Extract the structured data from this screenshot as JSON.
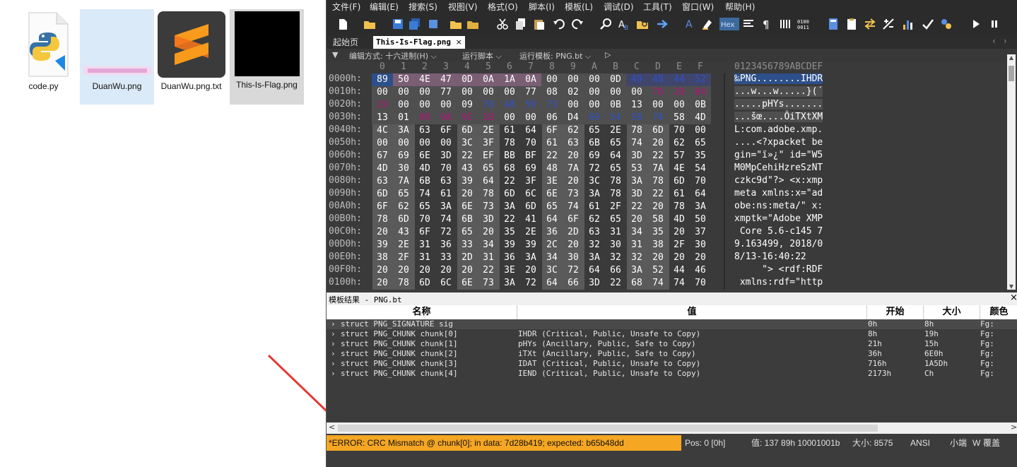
{
  "desktop": {
    "icons": [
      {
        "label": "code.py"
      },
      {
        "label": "DuanWu.png"
      },
      {
        "label": "DuanWu.png.txt"
      },
      {
        "label": "This-Is-Flag.png"
      }
    ]
  },
  "menu": [
    "文件(F)",
    "编辑(E)",
    "搜索(S)",
    "视图(V)",
    "格式(O)",
    "脚本(I)",
    "模板(L)",
    "调试(D)",
    "工具(T)",
    "窗口(W)",
    "帮助(H)"
  ],
  "tabs": {
    "start": "起始页",
    "file": "This-Is-Flag.png"
  },
  "editbar": {
    "edit_mode": "编辑方式: 十六进制(H) ⌵",
    "run_script": "运行脚本 ⌵",
    "run_template": "运行模板: PNG.bt ⌵"
  },
  "hex": {
    "column_headers": [
      "0",
      "1",
      "2",
      "3",
      "4",
      "5",
      "6",
      "7",
      "8",
      "9",
      "A",
      "B",
      "C",
      "D",
      "E",
      "F"
    ],
    "ascii_header": "0123456789ABCDEF",
    "rows": [
      {
        "addr": "0000h:",
        "bytes": [
          "89",
          "50",
          "4E",
          "47",
          "0D",
          "0A",
          "1A",
          "0A",
          "00",
          "00",
          "00",
          "0D",
          "49",
          "48",
          "44",
          "52"
        ],
        "ascii": "‰PNG........IHDR"
      },
      {
        "addr": "0010h:",
        "bytes": [
          "00",
          "00",
          "00",
          "77",
          "00",
          "00",
          "00",
          "77",
          "08",
          "02",
          "00",
          "00",
          "00",
          "7D",
          "28",
          "B4"
        ],
        "ascii": "...w...w.....}(´"
      },
      {
        "addr": "0020h:",
        "bytes": [
          "19",
          "00",
          "00",
          "00",
          "09",
          "70",
          "48",
          "59",
          "73",
          "00",
          "00",
          "0B",
          "13",
          "00",
          "00",
          "0B"
        ],
        "ascii": ".....pHYs......."
      },
      {
        "addr": "0030h:",
        "bytes": [
          "13",
          "01",
          "00",
          "9A",
          "9C",
          "18",
          "00",
          "00",
          "06",
          "D4",
          "69",
          "54",
          "58",
          "74",
          "58",
          "4D"
        ],
        "ascii": "...šœ....ÔiTXtXM"
      },
      {
        "addr": "0040h:",
        "bytes": [
          "4C",
          "3A",
          "63",
          "6F",
          "6D",
          "2E",
          "61",
          "64",
          "6F",
          "62",
          "65",
          "2E",
          "78",
          "6D",
          "70",
          "00"
        ],
        "ascii": "L:com.adobe.xmp."
      },
      {
        "addr": "0050h:",
        "bytes": [
          "00",
          "00",
          "00",
          "00",
          "3C",
          "3F",
          "78",
          "70",
          "61",
          "63",
          "6B",
          "65",
          "74",
          "20",
          "62",
          "65"
        ],
        "ascii": "....<?xpacket be"
      },
      {
        "addr": "0060h:",
        "bytes": [
          "67",
          "69",
          "6E",
          "3D",
          "22",
          "EF",
          "BB",
          "BF",
          "22",
          "20",
          "69",
          "64",
          "3D",
          "22",
          "57",
          "35"
        ],
        "ascii": "gin=\"ï»¿\" id=\"W5"
      },
      {
        "addr": "0070h:",
        "bytes": [
          "4D",
          "30",
          "4D",
          "70",
          "43",
          "65",
          "68",
          "69",
          "48",
          "7A",
          "72",
          "65",
          "53",
          "7A",
          "4E",
          "54"
        ],
        "ascii": "M0MpCehiHzreSzNT"
      },
      {
        "addr": "0080h:",
        "bytes": [
          "63",
          "7A",
          "6B",
          "63",
          "39",
          "64",
          "22",
          "3F",
          "3E",
          "20",
          "3C",
          "78",
          "3A",
          "78",
          "6D",
          "70"
        ],
        "ascii": "czkc9d\"?> <x:xmp"
      },
      {
        "addr": "0090h:",
        "bytes": [
          "6D",
          "65",
          "74",
          "61",
          "20",
          "78",
          "6D",
          "6C",
          "6E",
          "73",
          "3A",
          "78",
          "3D",
          "22",
          "61",
          "64"
        ],
        "ascii": "meta xmlns:x=\"ad"
      },
      {
        "addr": "00A0h:",
        "bytes": [
          "6F",
          "62",
          "65",
          "3A",
          "6E",
          "73",
          "3A",
          "6D",
          "65",
          "74",
          "61",
          "2F",
          "22",
          "20",
          "78",
          "3A"
        ],
        "ascii": "obe:ns:meta/\" x:"
      },
      {
        "addr": "00B0h:",
        "bytes": [
          "78",
          "6D",
          "70",
          "74",
          "6B",
          "3D",
          "22",
          "41",
          "64",
          "6F",
          "62",
          "65",
          "20",
          "58",
          "4D",
          "50"
        ],
        "ascii": "xmptk=\"Adobe XMP"
      },
      {
        "addr": "00C0h:",
        "bytes": [
          "20",
          "43",
          "6F",
          "72",
          "65",
          "20",
          "35",
          "2E",
          "36",
          "2D",
          "63",
          "31",
          "34",
          "35",
          "20",
          "37"
        ],
        "ascii": " Core 5.6-c145 7"
      },
      {
        "addr": "00D0h:",
        "bytes": [
          "39",
          "2E",
          "31",
          "36",
          "33",
          "34",
          "39",
          "39",
          "2C",
          "20",
          "32",
          "30",
          "31",
          "38",
          "2F",
          "30"
        ],
        "ascii": "9.163499, 2018/0"
      },
      {
        "addr": "00E0h:",
        "bytes": [
          "38",
          "2F",
          "31",
          "33",
          "2D",
          "31",
          "36",
          "3A",
          "34",
          "30",
          "3A",
          "32",
          "32",
          "20",
          "20",
          "20"
        ],
        "ascii": "8/13-16:40:22   "
      },
      {
        "addr": "00F0h:",
        "bytes": [
          "20",
          "20",
          "20",
          "20",
          "20",
          "22",
          "3E",
          "20",
          "3C",
          "72",
          "64",
          "66",
          "3A",
          "52",
          "44",
          "46"
        ],
        "ascii": "     \"> <rdf:RDF"
      },
      {
        "addr": "0100h:",
        "bytes": [
          "20",
          "78",
          "6D",
          "6C",
          "6E",
          "73",
          "3A",
          "72",
          "64",
          "66",
          "3D",
          "22",
          "68",
          "74",
          "74",
          "70"
        ],
        "ascii": " xmlns:rdf=\"http"
      }
    ]
  },
  "template": {
    "title": "模板结果 - PNG.bt",
    "columns": [
      "名称",
      "值",
      "开始",
      "大小",
      "颜色"
    ],
    "rows": [
      {
        "name": "struct PNG_SIGNATURE sig",
        "value": "",
        "start": "0h",
        "size": "8h",
        "color": "Fg:"
      },
      {
        "name": "struct PNG_CHUNK chunk[0]",
        "value": "IHDR  (Critical, Public, Unsafe to Copy)",
        "start": "8h",
        "size": "19h",
        "color": "Fg:"
      },
      {
        "name": "struct PNG_CHUNK chunk[1]",
        "value": "pHYs  (Ancillary, Public, Safe to Copy)",
        "start": "21h",
        "size": "15h",
        "color": "Fg:"
      },
      {
        "name": "struct PNG_CHUNK chunk[2]",
        "value": "iTXt  (Ancillary, Public, Safe to Copy)",
        "start": "36h",
        "size": "6E0h",
        "color": "Fg:"
      },
      {
        "name": "struct PNG_CHUNK chunk[3]",
        "value": "IDAT  (Critical, Public, Unsafe to Copy)",
        "start": "716h",
        "size": "1A5Dh",
        "color": "Fg:"
      },
      {
        "name": "struct PNG_CHUNK chunk[4]",
        "value": "IEND  (Critical, Public, Unsafe to Copy)",
        "start": "2173h",
        "size": "Ch",
        "color": "Fg:"
      }
    ]
  },
  "status": {
    "error": "*ERROR: CRC Mismatch @ chunk[0]; in data: 7d28b419; expected: b65b48dd",
    "pos": "Pos: 0 [0h]",
    "value": "值: 137 89h 10001001b",
    "size": "大小: 8575",
    "encoding": "ANSI",
    "endian": "小端",
    "w": "W",
    "mode": "覆盖"
  },
  "colors": {
    "error_bg": "#f5a623",
    "arrow": "#e53935",
    "blue_byte": "#2f52c8",
    "purple_byte": "#b0147a"
  }
}
